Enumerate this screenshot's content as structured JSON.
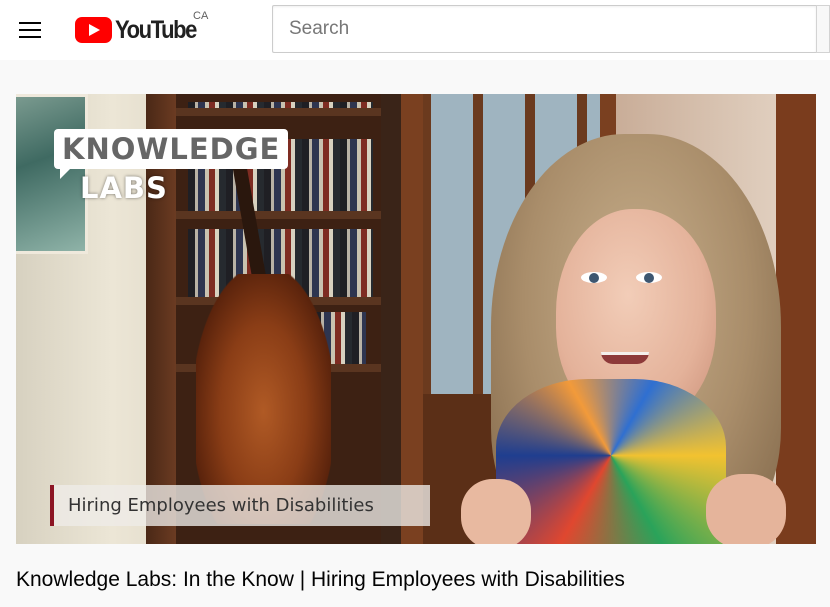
{
  "masthead": {
    "logo_text": "YouTube",
    "country_code": "CA",
    "search_placeholder": "Search",
    "search_value": ""
  },
  "video": {
    "title": "Knowledge Labs: In the Know | Hiring Employees with Disabilities",
    "overlay_logo_line1": "KNOWLEDGE",
    "overlay_logo_line2": "LABS",
    "lower_third_caption": "Hiring Employees with Disabilities"
  },
  "colors": {
    "brand_red": "#ff0000",
    "lower_third_accent": "#8c1524"
  },
  "icons": {
    "menu": "hamburger-menu-icon",
    "logo": "youtube-play-icon"
  }
}
